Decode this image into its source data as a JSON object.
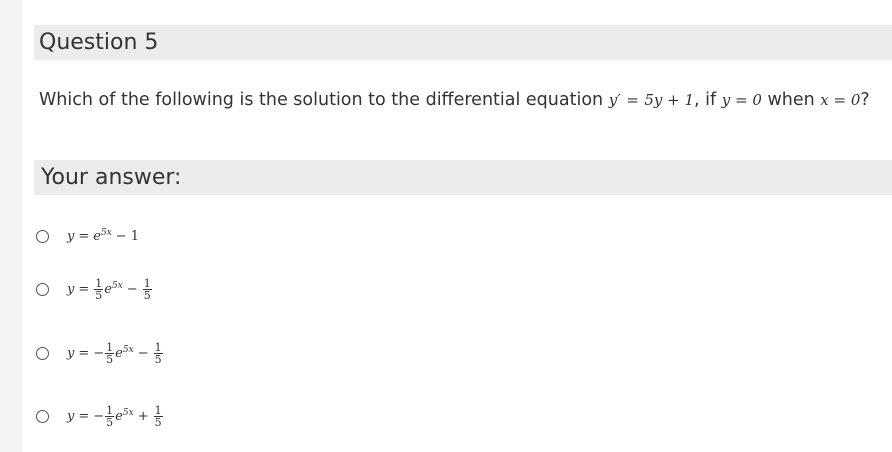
{
  "question": {
    "title": "Question 5",
    "text_before": "Which of the following is the solution to the differential equation",
    "eq_lhs": "y′",
    "eq_equals": "=",
    "eq_rhs": "5y + 1",
    "text_if": ", if",
    "cond_y": "y = 0",
    "text_when": "when",
    "cond_x": "x = 0",
    "text_end": "?"
  },
  "answer": {
    "label": "Your answer:"
  },
  "options": [
    {
      "y": "y",
      "eq": "=",
      "sign1": "",
      "coef_num": "",
      "coef_den": "",
      "e": "e",
      "exp": "5x",
      "op": "−",
      "const_num": "",
      "const_den": "",
      "const": "1"
    },
    {
      "y": "y",
      "eq": "=",
      "sign1": "",
      "coef_num": "1",
      "coef_den": "5",
      "e": "e",
      "exp": "5x",
      "op": "−",
      "const_num": "1",
      "const_den": "5",
      "const": ""
    },
    {
      "y": "y",
      "eq": "=",
      "sign1": "−",
      "coef_num": "1",
      "coef_den": "5",
      "e": "e",
      "exp": "5x",
      "op": "−",
      "const_num": "1",
      "const_den": "5",
      "const": ""
    },
    {
      "y": "y",
      "eq": "=",
      "sign1": "−",
      "coef_num": "1",
      "coef_den": "5",
      "e": "e",
      "exp": "5x",
      "op": "+",
      "const_num": "1",
      "const_den": "5",
      "const": ""
    }
  ]
}
